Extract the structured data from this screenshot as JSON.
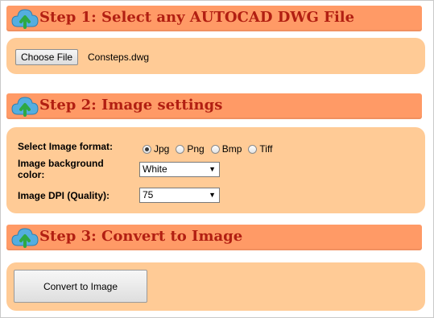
{
  "colors": {
    "header_bg": "#ff9a66",
    "header_text": "#b21f12",
    "panel_bg": "#ffcb96",
    "cloud": "#54aee0",
    "arrow": "#2ea843"
  },
  "steps": [
    {
      "title": "Step 1: Select any AUTOCAD DWG File",
      "icon": "cloud-upload-icon"
    },
    {
      "title": "Step 2: Image settings",
      "icon": "cloud-upload-icon"
    },
    {
      "title": "Step 3: Convert to Image",
      "icon": "cloud-upload-icon"
    }
  ],
  "file": {
    "button_label": "Choose File",
    "file_name": "Consteps.dwg"
  },
  "settings": {
    "format_label": "Select Image format:",
    "formats": [
      {
        "label": "Jpg",
        "checked": true
      },
      {
        "label": "Png",
        "checked": false
      },
      {
        "label": "Bmp",
        "checked": false
      },
      {
        "label": "Tiff",
        "checked": false
      }
    ],
    "bg_label": "Image background color:",
    "bg_value": "White",
    "dpi_label": "Image DPI (Quality):",
    "dpi_value": "75"
  },
  "convert": {
    "button_label": "Convert to Image"
  }
}
